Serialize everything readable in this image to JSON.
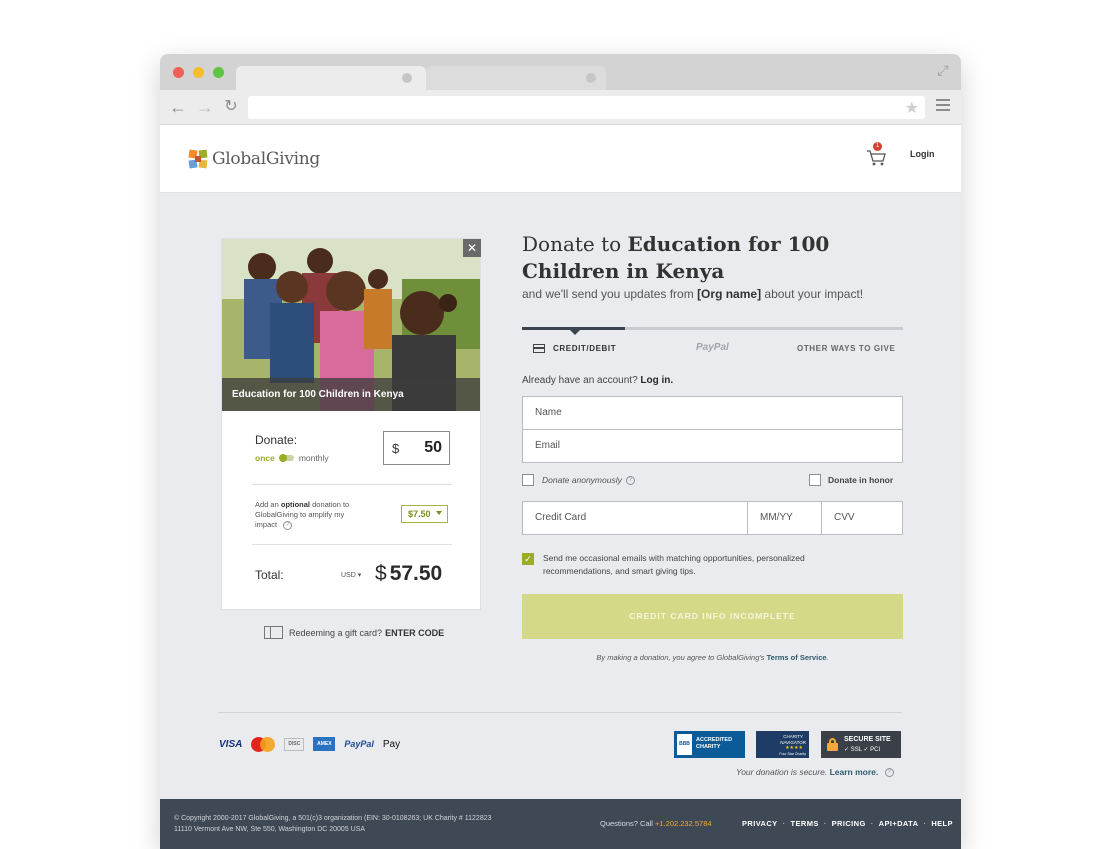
{
  "site": {
    "logo_text": "GlobalGiving",
    "cart_count": "1",
    "login_label": "Login"
  },
  "project": {
    "caption": "Education for 100 Children in Kenya"
  },
  "donation": {
    "label": "Donate:",
    "freq_once": "once",
    "freq_monthly": "monthly",
    "currency_symbol": "$",
    "amount": "50",
    "optional_prefix": "Add an ",
    "optional_bold": "optional",
    "optional_suffix": " donation to GlobalGiving to amplify my impact",
    "tip_value": "$7.50",
    "total_label": "Total:",
    "currency_code": "USD",
    "total_symbol": "$",
    "total_value": "57.50"
  },
  "gift": {
    "text": "Redeeming a gift card?",
    "code_link": "ENTER CODE"
  },
  "form": {
    "heading_prefix": "Donate to ",
    "heading_bold": "Education for 100 Children in Kenya",
    "sub_prefix": "and we'll send you updates from ",
    "sub_bold": "[Org name]",
    "sub_suffix": " about your impact!",
    "tabs": {
      "credit": "CREDIT/DEBIT",
      "paypal": "PayPal",
      "other": "OTHER WAYS TO GIVE"
    },
    "account_text": "Already have an account?",
    "login_link": "Log in.",
    "name_placeholder": "Name",
    "email_placeholder": "Email",
    "anonymous_label": "Donate anonymously",
    "honor_label": "Donate in honor",
    "cc_placeholder": "Credit Card",
    "mmyy_placeholder": "MM/YY",
    "cvv_placeholder": "CVV",
    "emails_label": "Send me occasional emails with matching opportunities, personalized recommendations, and smart giving tips.",
    "submit_label": "CREDIT CARD INFO INCOMPLETE",
    "terms_prefix": "By making a donation, you agree to GlobalGiving's ",
    "terms_link": "Terms of Service",
    "terms_suffix": "."
  },
  "payment_logos": {
    "visa": "VISA",
    "discover": "DISC",
    "amex": "AMEX",
    "paypal": "PayPal",
    "applepay": "Pay"
  },
  "badges": {
    "bbb_seal": "BBB",
    "bbb_line1": "ACCREDITED",
    "bbb_line2": "CHARITY",
    "cn_line1": "CHARITY",
    "cn_line2": "NAVIGATOR",
    "cn_line3": "Four Star Charity",
    "secure_title": "SECURE SITE",
    "secure_sub": "✓ SSL  ✓ PCI"
  },
  "secure_note": {
    "text": "Your donation is secure.",
    "link": "Learn more."
  },
  "footer": {
    "copyright_line1": "© Copyright 2000-2017 GlobalGiving, a 501(c)3 organization (EIN: 30-0108263; UK Charity # 1122823",
    "copyright_line2": "11110 Vermont Ave NW, Ste 550, Washington DC 20005 USA",
    "questions_prefix": "Questions? Call ",
    "phone": "+1.202.232.5784",
    "links": [
      "PRIVACY",
      "TERMS",
      "PRICING",
      "API+DATA",
      "HELP"
    ]
  },
  "colors": {
    "accent_green": "#9bac26",
    "button_disabled": "#d4d988",
    "footer_bg": "#3f4956",
    "link_blue": "#2f5a6e"
  }
}
